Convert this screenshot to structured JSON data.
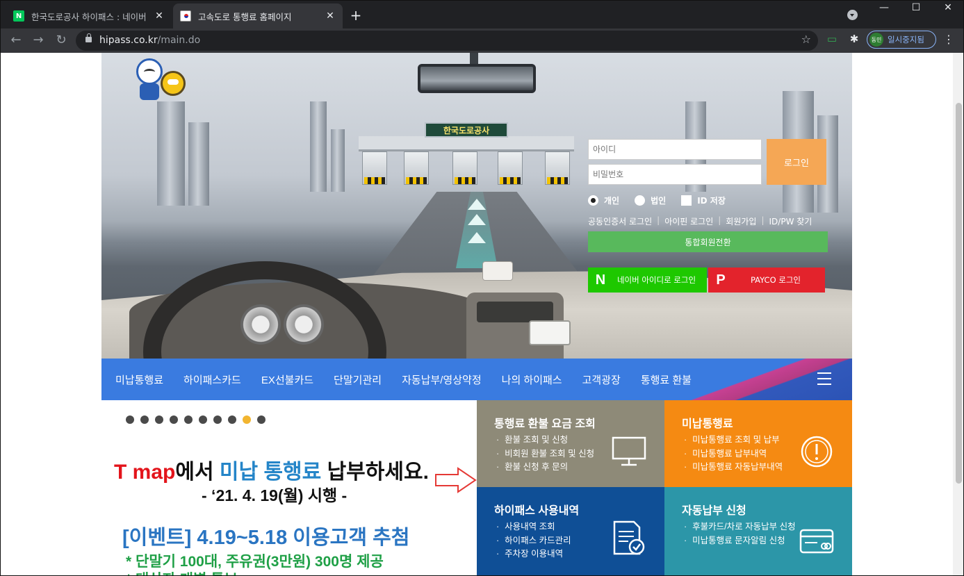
{
  "browser": {
    "tabs": [
      {
        "title": "한국도로공사 하이패스 : 네이버",
        "favicon": "N",
        "active": false
      },
      {
        "title": "고속도로 통행료 홈페이지",
        "favicon": "",
        "active": true
      }
    ],
    "new_tab": "+",
    "url_host": "hipass.co.kr",
    "url_path": "/main.do",
    "profile_avatar": "동민",
    "profile_label": "일시중지됨",
    "window_min": "—",
    "window_max": "☐",
    "window_close": "✕"
  },
  "hero": {
    "toll_sign": "한국도로공사"
  },
  "login": {
    "id_placeholder": "아이디",
    "pw_placeholder": "비밀번호",
    "login_button": "로그인",
    "radio_personal": "개인",
    "radio_corp": "법인",
    "save_id": "ID 저장",
    "link_cert": "공동인증서 로그인",
    "link_ipin": "아이핀 로그인",
    "link_join": "회원가입",
    "link_find": "ID/PW 찾기",
    "sep": "|",
    "convert_button": "통합회원전환",
    "naver_logo": "N",
    "naver_login": "네이버 아이디로 로그인",
    "payco_logo": "P",
    "payco_login": "PAYCO 로그인"
  },
  "gnb": {
    "items": [
      "미납통행료",
      "하이패스카드",
      "EX선불카드",
      "단말기관리",
      "자동납부/영상약정",
      "나의 하이패스",
      "고객광장",
      "통행료 환불"
    ]
  },
  "banner": {
    "dot_count": 10,
    "active_dot": 8,
    "line1_red": "T map",
    "line1_a": "에서 ",
    "line1_blue": "미납 통행료",
    "line1_b": " 납부하세요.",
    "line2": "- ‘21. 4. 19(월) 시행 -",
    "event": "[이벤트] 4.19~5.18 이용고객 추첨",
    "green1": "* 단말기 100대, 주유권(3만원) 300명 제공",
    "green2": "* 대상자 개별 통보"
  },
  "tiles": [
    {
      "title": "통행료 환불 요금 조회",
      "items": [
        "환불 조회 및 신청",
        "비회원 환불 조회 및 신청",
        "환불 신청 후 문의"
      ],
      "icon": "monitor-icon"
    },
    {
      "title": "미납통행료",
      "items": [
        "미납통행료 조회 및 납부",
        "미납통행료 납부내역",
        "미납통행료 자동납부내역"
      ],
      "icon": "alert-icon"
    },
    {
      "title": "하이패스 사용내역",
      "items": [
        "사용내역 조회",
        "하이패스 카드관리",
        "주차장 이용내역"
      ],
      "icon": "document-check-icon"
    },
    {
      "title": "자동납부 신청",
      "items": [
        "후불카드/차로 자동납부 신청",
        "미납통행료 문자알림 신청"
      ],
      "icon": "card-icon"
    }
  ],
  "colors": {
    "gnb": "#3a7be0",
    "login_button": "#f5a755",
    "tile_refund": "#8e8a78",
    "tile_unpaid": "#f58a12",
    "tile_usage": "#0f4f96",
    "tile_autopay": "#2c96a8"
  }
}
